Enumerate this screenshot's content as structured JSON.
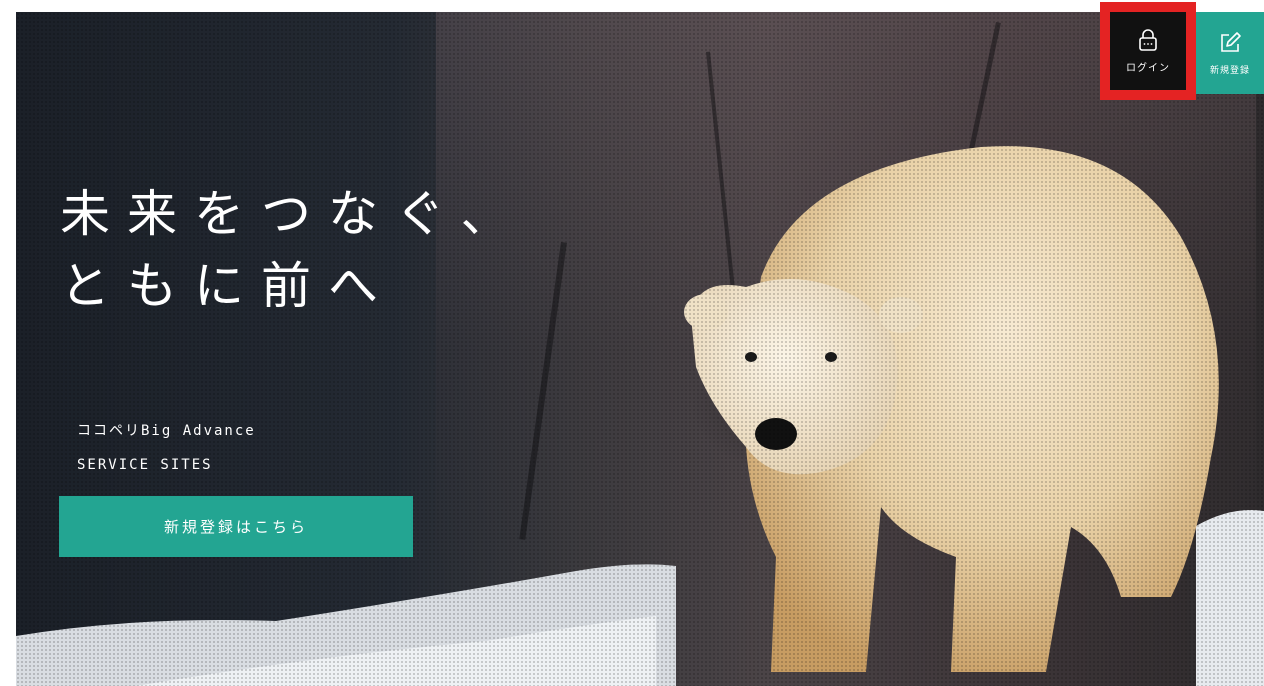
{
  "header": {
    "login_label": "ログイン",
    "login_icon": "lock-icon",
    "register_label": "新規登録",
    "register_icon": "edit-icon"
  },
  "hero": {
    "headline_line1": "未来をつなぐ、",
    "headline_line2": "ともに前へ",
    "subtitle_line1": "ココペリBig Advance",
    "subtitle_line2": "SERVICE SITES",
    "cta_label": "新規登録はこちら",
    "image": "polar-bear-photo"
  },
  "colors": {
    "accent": "#23a592",
    "highlight": "#e42323",
    "login_bg": "#111111"
  }
}
